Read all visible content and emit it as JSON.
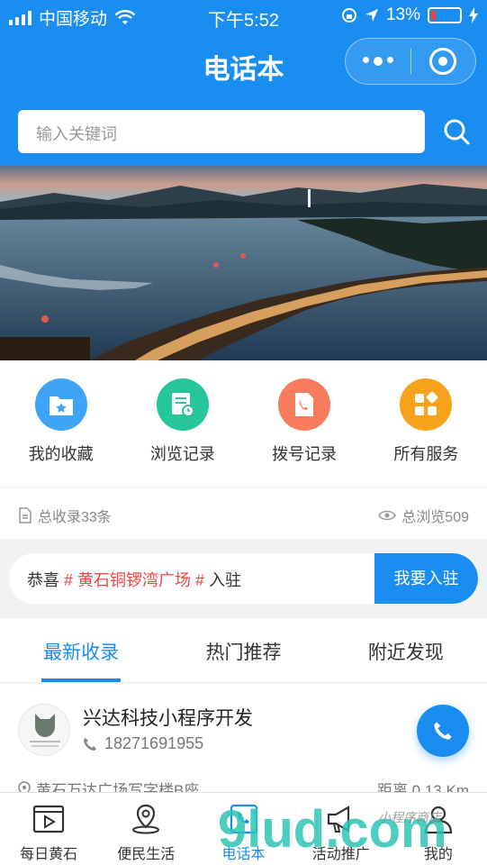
{
  "status_bar": {
    "carrier": "中国移动",
    "time": "下午5:52",
    "battery": "13%",
    "battery_level": 0.13
  },
  "header": {
    "title": "电话本"
  },
  "search": {
    "placeholder": "输入关键词"
  },
  "quick_menu": [
    {
      "label": "我的收藏",
      "icon": "favorite-folder-icon",
      "color": "#3ea4f6"
    },
    {
      "label": "浏览记录",
      "icon": "history-icon",
      "color": "#26c59a"
    },
    {
      "label": "拨号记录",
      "icon": "call-log-icon",
      "color": "#f77b5d"
    },
    {
      "label": "所有服务",
      "icon": "all-services-icon",
      "color": "#f7a21b"
    }
  ],
  "stats": {
    "records": "总收录33条",
    "views": "总浏览509"
  },
  "notice": {
    "prefix": "恭喜",
    "highlight": "# 黄石铜锣湾广场 #",
    "suffix": "入驻",
    "join_label": "我要入驻"
  },
  "tabs": [
    {
      "label": "最新收录",
      "active": true
    },
    {
      "label": "热门推荐",
      "active": false
    },
    {
      "label": "附近发现",
      "active": false
    }
  ],
  "listing": {
    "name": "兴达科技小程序开发",
    "phone": "18271691955",
    "address": "黄石万达广场写字楼B座",
    "distance": "距离 0.13 Km"
  },
  "tab_bar": [
    {
      "label": "每日黄石",
      "icon": "video-icon",
      "active": false
    },
    {
      "label": "便民生活",
      "icon": "location-pin-icon",
      "active": false
    },
    {
      "label": "电话本",
      "icon": "phone-icon",
      "active": true
    },
    {
      "label": "活动推广",
      "icon": "megaphone-icon",
      "active": false
    },
    {
      "label": "我的",
      "icon": "user-icon",
      "active": false
    }
  ],
  "watermark": {
    "text": "9lud.com",
    "subtext": "小程序商店"
  },
  "colors": {
    "primary": "#1a8ef0",
    "highlight": "#ef4444"
  }
}
